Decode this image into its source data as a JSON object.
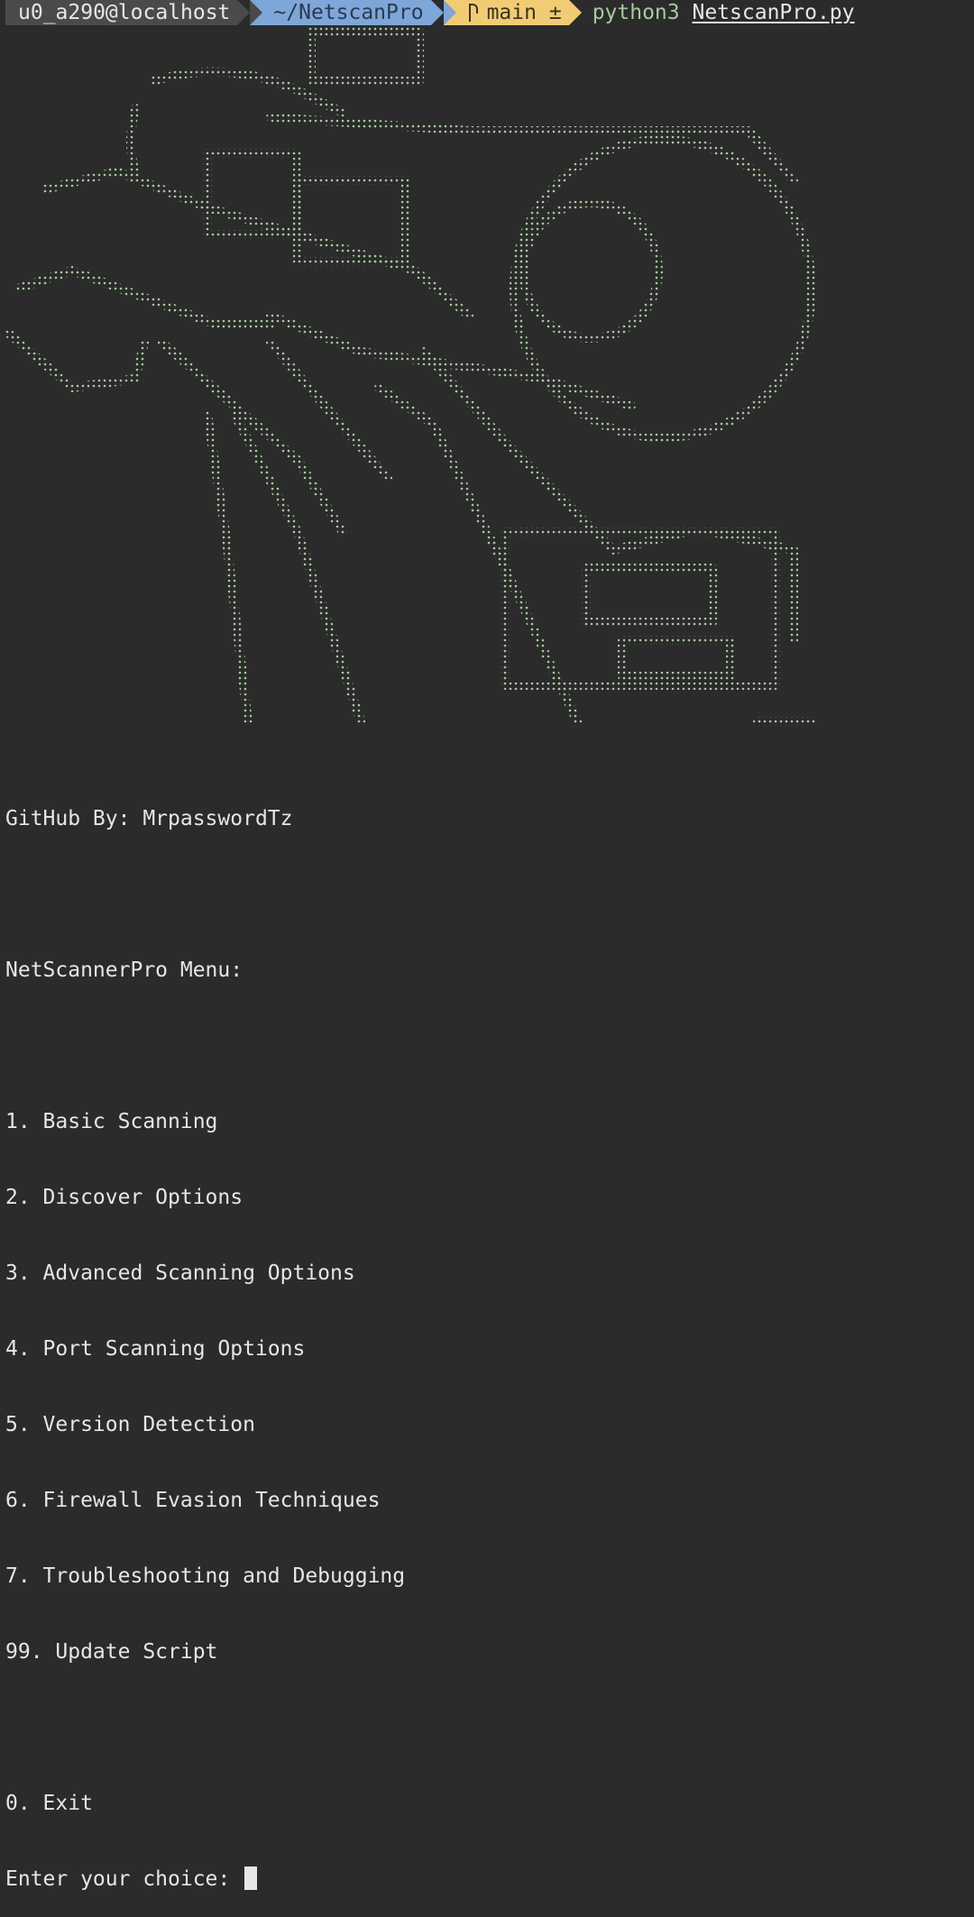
{
  "prompt": {
    "user_host": "u0_a290@localhost",
    "directory": "~/NetscanPro",
    "git_branch": "main",
    "git_status": "±",
    "command": "python3",
    "argument": "NetscanPro.py"
  },
  "banner": {
    "art_icon": "ascii-art-motorcycle-dots",
    "credit": "GitHub By: MrpasswordTz"
  },
  "menu": {
    "title": "NetScannerPro Menu:",
    "items": [
      "1. Basic Scanning",
      "2. Discover Options",
      "3. Advanced Scanning Options",
      "4. Port Scanning Options",
      "5. Version Detection",
      "6. Firewall Evasion Techniques",
      "7. Troubleshooting and Debugging",
      "99. Update Script"
    ],
    "exit_item": "0. Exit",
    "input_prompt": "Enter your choice: "
  },
  "colors": {
    "background": "#2b2b2b",
    "text": "#e6e6e6",
    "art_dots": "#a7c9a0",
    "seg_user": "#4a4a4a",
    "seg_dir": "#7fa6d8",
    "seg_git": "#f2cc74"
  }
}
